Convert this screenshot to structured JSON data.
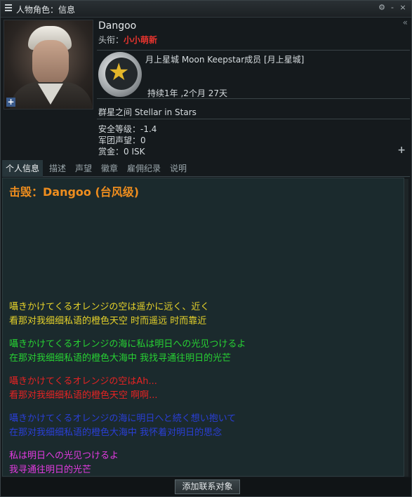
{
  "window": {
    "title": "人物角色：信息",
    "controls": {
      "settings": "⚙",
      "minimize": "-",
      "close": "×"
    },
    "collapse": "«"
  },
  "character": {
    "name": "Dangoo",
    "rank_label": "头衔：",
    "rank_value": "小小萌新",
    "corporation": "月上星城 Moon Keepstar成员 [月上星城]",
    "corp_duration": "持续1年 ,2个月 27天",
    "alliance": "群星之间 Stellar in Stars",
    "security": "安全等级：-1.4",
    "standing": "军团声望：0",
    "bounty": "赏金：0 ISK"
  },
  "tabs": [
    "个人信息",
    "描述",
    "声望",
    "徽章",
    "雇佣纪录",
    "说明"
  ],
  "content": {
    "heading": "击毁：Dangoo (台风级)",
    "lines": [
      {
        "text": "囁きかけてくるオレンジの空は遥かに远く、近く",
        "color": "yellow"
      },
      {
        "text": "看那对我细细私语的橙色天空 时而遥远 时而靠近",
        "color": "yellow"
      },
      {
        "text": "囁きかけてくるオレンジの海に私は明日への光见つけるよ",
        "color": "green"
      },
      {
        "text": "在那对我细细私语的橙色大海中 我找寻通往明日的光芒",
        "color": "green"
      },
      {
        "text": "囁きかけてくるオレンジの空はAh...",
        "color": "red"
      },
      {
        "text": "看那对我细细私语的橙色天空 啊啊...",
        "color": "red"
      },
      {
        "text": "囁きかけてくるオレンジの海に明日へと続く想い抱いて",
        "color": "blue"
      },
      {
        "text": "在那对我细细私语的橙色大海中 我怀着对明日的思念",
        "color": "blue"
      },
      {
        "text": "私は明日への光见つけるよ",
        "color": "magenta"
      },
      {
        "text": "我寻通往明日的光芒",
        "color": "magenta"
      }
    ]
  },
  "add_contact_button": "添加联系对象"
}
